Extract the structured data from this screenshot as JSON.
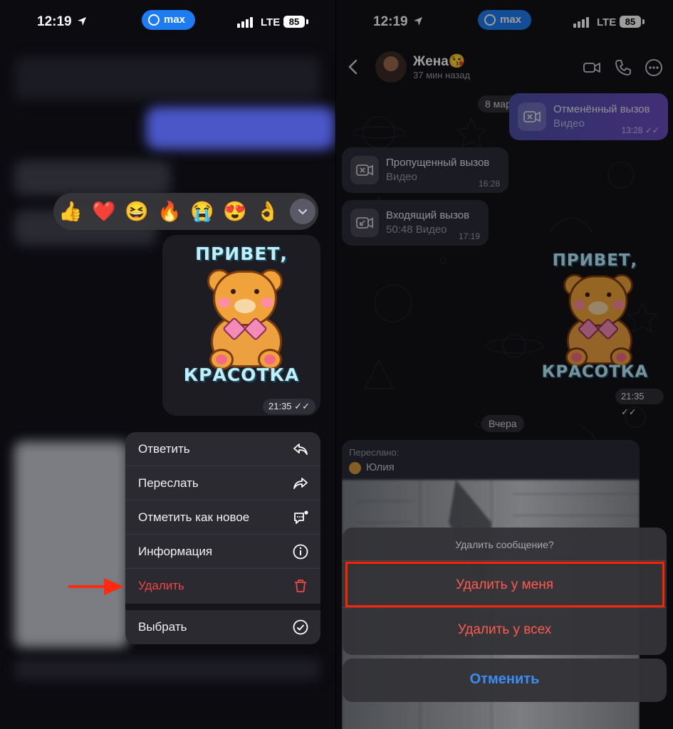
{
  "status_bar": {
    "time": "12:19",
    "app_pill": "max",
    "network": "LTE",
    "battery": "85"
  },
  "left": {
    "reactions": [
      "👍",
      "❤️",
      "😆",
      "🔥",
      "😭",
      "😍",
      "👌"
    ],
    "sticker": {
      "line1": "ПРИВЕТ,",
      "line2": "КРАСОТКА",
      "time": "21:35"
    },
    "context_menu": {
      "items": [
        {
          "label": "Ответить",
          "icon": "reply-icon"
        },
        {
          "label": "Переслать",
          "icon": "forward-icon"
        },
        {
          "label": "Отметить как новое",
          "icon": "mark-unread-icon"
        },
        {
          "label": "Информация",
          "icon": "info-icon"
        },
        {
          "label": "Удалить",
          "icon": "trash-icon",
          "destructive": true
        }
      ],
      "select": {
        "label": "Выбрать",
        "icon": "check-circle-icon"
      }
    }
  },
  "right": {
    "header": {
      "name": "Жена😘",
      "status": "37 мин назад"
    },
    "date1": "8 марта",
    "messages": [
      {
        "title": "Отменённый вызов",
        "subtitle": "Видео",
        "time": "13:28"
      },
      {
        "title": "Пропущенный вызов",
        "subtitle": "Видео",
        "time": "16:28"
      },
      {
        "title": "Входящий вызов",
        "subtitle": "50:48  Видео",
        "time": "17:19"
      }
    ],
    "sticker": {
      "line1": "ПРИВЕТ,",
      "line2": "КРАСОТКА",
      "time": "21:35"
    },
    "date2": "Вчера",
    "forwarded": {
      "label": "Переслано:",
      "from": "Юлия"
    },
    "sheet": {
      "question": "Удалить сообщение?",
      "delete_for_me": "Удалить у меня",
      "delete_for_all": "Удалить у всех",
      "cancel": "Отменить"
    }
  },
  "colors": {
    "accent": "#3b8cf5",
    "destructive": "#ff5a4f",
    "highlight": "#ff2200",
    "brand": "#1d7cf2"
  }
}
